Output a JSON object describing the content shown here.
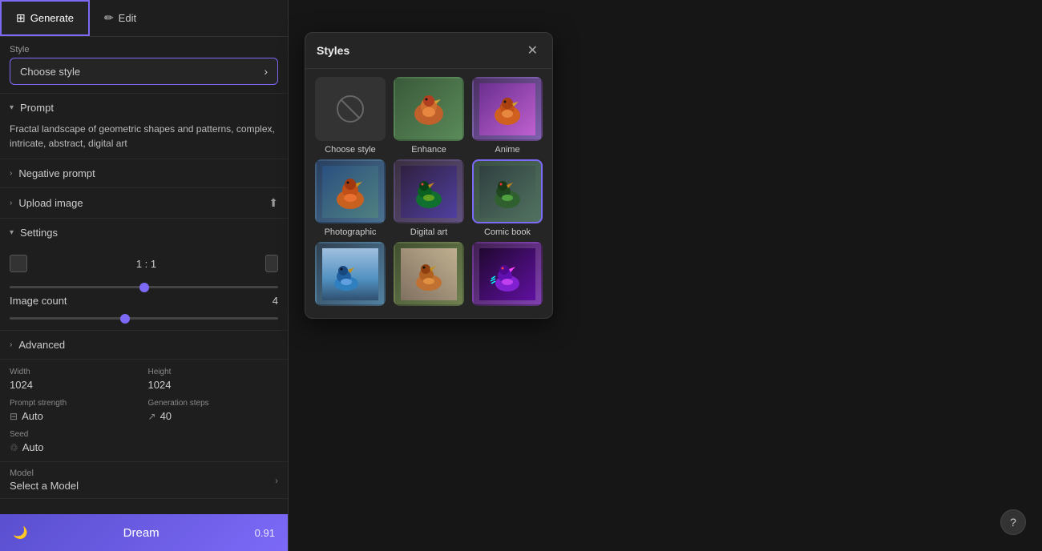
{
  "tabs": [
    {
      "id": "generate",
      "label": "Generate",
      "icon": "⊞",
      "active": true
    },
    {
      "id": "edit",
      "label": "Edit",
      "icon": "✏",
      "active": false
    }
  ],
  "style_selector": {
    "label": "Style",
    "placeholder": "Choose style"
  },
  "sections": {
    "prompt": {
      "label": "Prompt",
      "content": "Fractal landscape of geometric shapes and patterns, complex, intricate, abstract, digital art"
    },
    "negative_prompt": {
      "label": "Negative prompt"
    },
    "upload_image": {
      "label": "Upload image"
    },
    "settings": {
      "label": "Settings",
      "ratio": "1 : 1",
      "image_count_label": "Image count",
      "image_count_value": "4"
    },
    "advanced": {
      "label": "Advanced",
      "width_label": "Width",
      "width_value": "1024",
      "height_label": "Height",
      "height_value": "1024",
      "prompt_strength_label": "Prompt strength",
      "prompt_strength_value": "Auto",
      "generation_steps_label": "Generation steps",
      "generation_steps_value": "40",
      "seed_label": "Seed",
      "seed_value": "Auto",
      "model_label": "Model",
      "model_value": "Select a Model"
    }
  },
  "dream_button": {
    "label": "Dream",
    "score": "0.91"
  },
  "styles_modal": {
    "title": "Styles",
    "items": [
      {
        "id": "choose_style",
        "label": "Choose style",
        "type": "none"
      },
      {
        "id": "enhance",
        "label": "Enhance",
        "type": "enhance"
      },
      {
        "id": "anime",
        "label": "Anime",
        "type": "anime"
      },
      {
        "id": "photographic",
        "label": "Photographic",
        "type": "photographic"
      },
      {
        "id": "digital_art",
        "label": "Digital art",
        "type": "digital_art"
      },
      {
        "id": "comic_book",
        "label": "Comic book",
        "type": "comic",
        "selected": true
      },
      {
        "id": "style_7",
        "label": "",
        "type": "row3a"
      },
      {
        "id": "style_8",
        "label": "",
        "type": "row3b"
      },
      {
        "id": "style_9",
        "label": "",
        "type": "row3c"
      }
    ]
  },
  "help": {
    "label": "?"
  }
}
